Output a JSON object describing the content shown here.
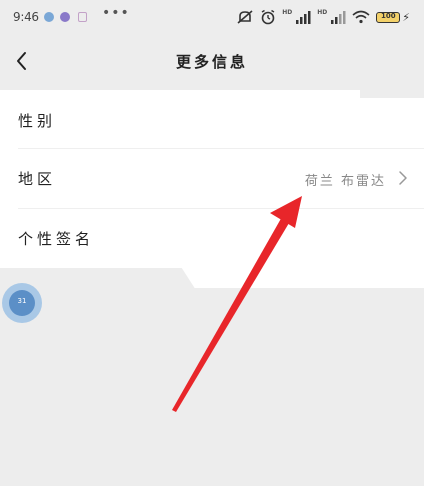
{
  "status_bar": {
    "time": "9:46",
    "more": "•••",
    "hd_1": "HD",
    "hd_2": "HD",
    "battery": "100"
  },
  "nav": {
    "title": "更多信息"
  },
  "profile": {
    "gender_label": "性别",
    "region_label": "地区",
    "region_value": "荷兰 布雷达",
    "signature_label": "个性签名"
  },
  "floating_bubble": {
    "text": "31"
  },
  "colors": {
    "arrow": "#e8262a",
    "background": "#ededed",
    "card": "#ffffff"
  }
}
